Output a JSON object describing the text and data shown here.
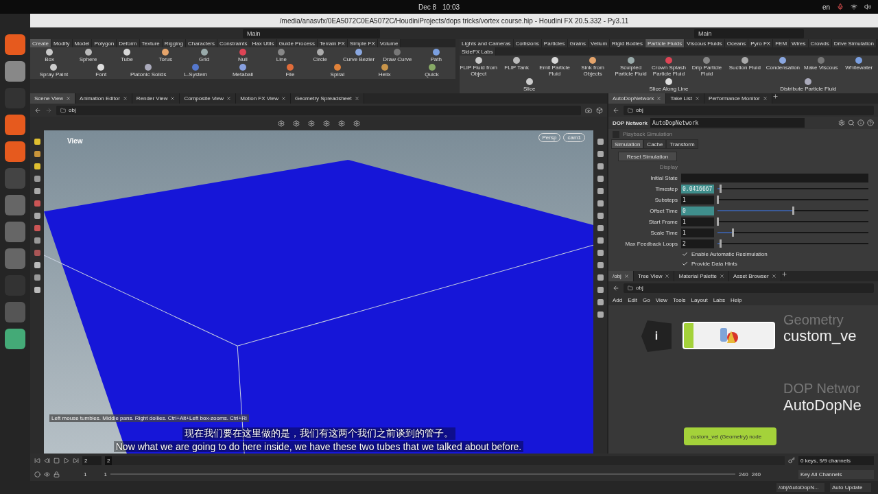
{
  "system_bar": {
    "date": "Dec 8",
    "time": "10:03",
    "language": "en"
  },
  "window": {
    "title": "/media/anasvfx/0EA5072C0EA5072C/HoudiniProjects/dops tricks/vortex course.hip - Houdini FX 20.5.332 - Py3.11"
  },
  "desktops": [
    "Main",
    "Main"
  ],
  "shelf_left": {
    "tabs": [
      {
        "label": "Create",
        "selected": true
      },
      {
        "label": "Modify",
        "selected": false
      },
      {
        "label": "Model",
        "selected": false
      },
      {
        "label": "Polygon",
        "selected": false
      },
      {
        "label": "Deform",
        "selected": false
      },
      {
        "label": "Texture",
        "selected": false
      },
      {
        "label": "Rigging",
        "selected": false
      },
      {
        "label": "Characters",
        "selected": false
      },
      {
        "label": "Constraints",
        "selected": false
      },
      {
        "label": "Hax Utils",
        "selected": false
      },
      {
        "label": "Guide Process",
        "selected": false
      },
      {
        "label": "Terrain FX",
        "selected": false
      },
      {
        "label": "Simple FX",
        "selected": false
      },
      {
        "label": "Volume",
        "selected": false
      }
    ],
    "tools": [
      "Box",
      "Sphere",
      "Tube",
      "Torus",
      "Grid",
      "Null",
      "Line",
      "Circle",
      "Curve Bezier",
      "Draw Curve",
      "Path",
      "Spray Paint",
      "Font",
      "Platonic Solids",
      "L-System",
      "Metaball",
      "File",
      "Spiral",
      "Helix",
      "Quick"
    ]
  },
  "shelf_right": {
    "tabs": [
      {
        "label": "Lights and Cameras",
        "selected": false
      },
      {
        "label": "Collisions",
        "selected": false
      },
      {
        "label": "Particles",
        "selected": false
      },
      {
        "label": "Grains",
        "selected": false
      },
      {
        "label": "Vellum",
        "selected": false
      },
      {
        "label": "Rigid Bodies",
        "selected": false
      },
      {
        "label": "Particle Fluids",
        "selected": true
      },
      {
        "label": "Viscous Fluids",
        "selected": false
      },
      {
        "label": "Oceans",
        "selected": false
      },
      {
        "label": "Pyro FX",
        "selected": false
      },
      {
        "label": "FEM",
        "selected": false
      },
      {
        "label": "Wires",
        "selected": false
      },
      {
        "label": "Crowds",
        "selected": false
      },
      {
        "label": "Drive Simulation",
        "selected": false
      },
      {
        "label": "SideFX Labs",
        "selected": false
      }
    ],
    "tools": [
      "FLIP Fluid from Object",
      "FLIP Tank",
      "Emit Particle Fluid",
      "Sink from Objects",
      "Sculpted Particle Fluid",
      "Crown Splash Particle Fluid",
      "Drip Particle Fluid",
      "Suction Fluid",
      "Condensation",
      "Make Viscous",
      "Whitewater",
      "Slice",
      "Slice Along Line",
      "Distribute Particle Fluid"
    ]
  },
  "pane_tabs_left": [
    {
      "label": "Scene View",
      "selected": true
    },
    {
      "label": "Animation Editor",
      "selected": false
    },
    {
      "label": "Render View",
      "selected": false
    },
    {
      "label": "Composite View",
      "selected": false
    },
    {
      "label": "Motion FX View",
      "selected": false
    },
    {
      "label": "Geometry Spreadsheet",
      "selected": false
    }
  ],
  "pane_tabs_right": [
    {
      "label": "AutoDopNetwork",
      "selected": true
    },
    {
      "label": "Take List",
      "selected": false
    },
    {
      "label": "Performance Monitor",
      "selected": false
    }
  ],
  "viewport": {
    "path": "obj",
    "title": "View",
    "camera_menus": [
      "Persp",
      "cam1"
    ],
    "hint": "Left mouse tumbles. Middle pans. Right dollies. Ctrl+Alt+Left box-zooms. Ctrl+Ri"
  },
  "parameters": {
    "path": "obj",
    "node_type": "DOP Network",
    "node_name": "AutoDopNetwork",
    "playback": {
      "label": "Playback Simulation",
      "checked": false,
      "disabled": true
    },
    "tabs": [
      {
        "label": "Simulation",
        "selected": true
      },
      {
        "label": "Cache",
        "selected": false
      },
      {
        "label": "Transform",
        "selected": false
      }
    ],
    "reset_button": "Reset Simulation",
    "display": {
      "label": "Display",
      "disabled": true
    },
    "fields": [
      {
        "kind": "text",
        "label": "Initial State"
      },
      {
        "kind": "slider",
        "label": "Timestep",
        "value": "0.0416667",
        "highlighted": true,
        "level": 0.02
      },
      {
        "kind": "slider",
        "label": "Substeps",
        "value": "1",
        "highlighted": false,
        "level": 0
      },
      {
        "kind": "slider",
        "label": "Offset Time",
        "value": "0",
        "highlighted": true,
        "level": 0.5
      },
      {
        "kind": "slider",
        "label": "Start Frame",
        "value": "1",
        "highlighted": false,
        "level": 0
      },
      {
        "kind": "slider",
        "label": "Scale Time",
        "value": "1",
        "highlighted": false,
        "level": 0.1
      },
      {
        "kind": "slider",
        "label": "Max Feedback Loops",
        "value": "2",
        "highlighted": false,
        "level": 0.02
      }
    ],
    "checkboxes": [
      {
        "label": "Enable Automatic Resimulation",
        "checked": true
      },
      {
        "label": "Provide Data Hints",
        "checked": true
      }
    ]
  },
  "network": {
    "tabs": [
      {
        "label": "/obj",
        "selected": true
      },
      {
        "label": "Tree View",
        "selected": false
      },
      {
        "label": "Material Palette",
        "selected": false
      },
      {
        "label": "Asset Browser",
        "selected": false
      }
    ],
    "path": "obj",
    "menu": [
      "Add",
      "Edit",
      "Go",
      "View",
      "Tools",
      "Layout",
      "Labs",
      "Help"
    ],
    "info": "i",
    "node_type": "Geometry",
    "node_name": "custom_ve",
    "network_type": "DOP Networ",
    "network_name": "AutoDopNe",
    "node_tooltip": "custom_vel (Geometry) node"
  },
  "subtitles": {
    "chinese": "现在我们要在这里做的是，我们有这两个我们之前谈到的管子。",
    "english": "Now what we are going to do here inside, we have these two tubes that we talked about before."
  },
  "timeline": {
    "frame": "2",
    "marker": "2",
    "range_start": "1",
    "current_start": "1",
    "current_end": "240",
    "range_end": "240",
    "keys": "0 keys, 9/9 channels",
    "key_all": "Key All Channels",
    "status_path": "/obj/AutoDopN...",
    "update": "Auto Update"
  }
}
